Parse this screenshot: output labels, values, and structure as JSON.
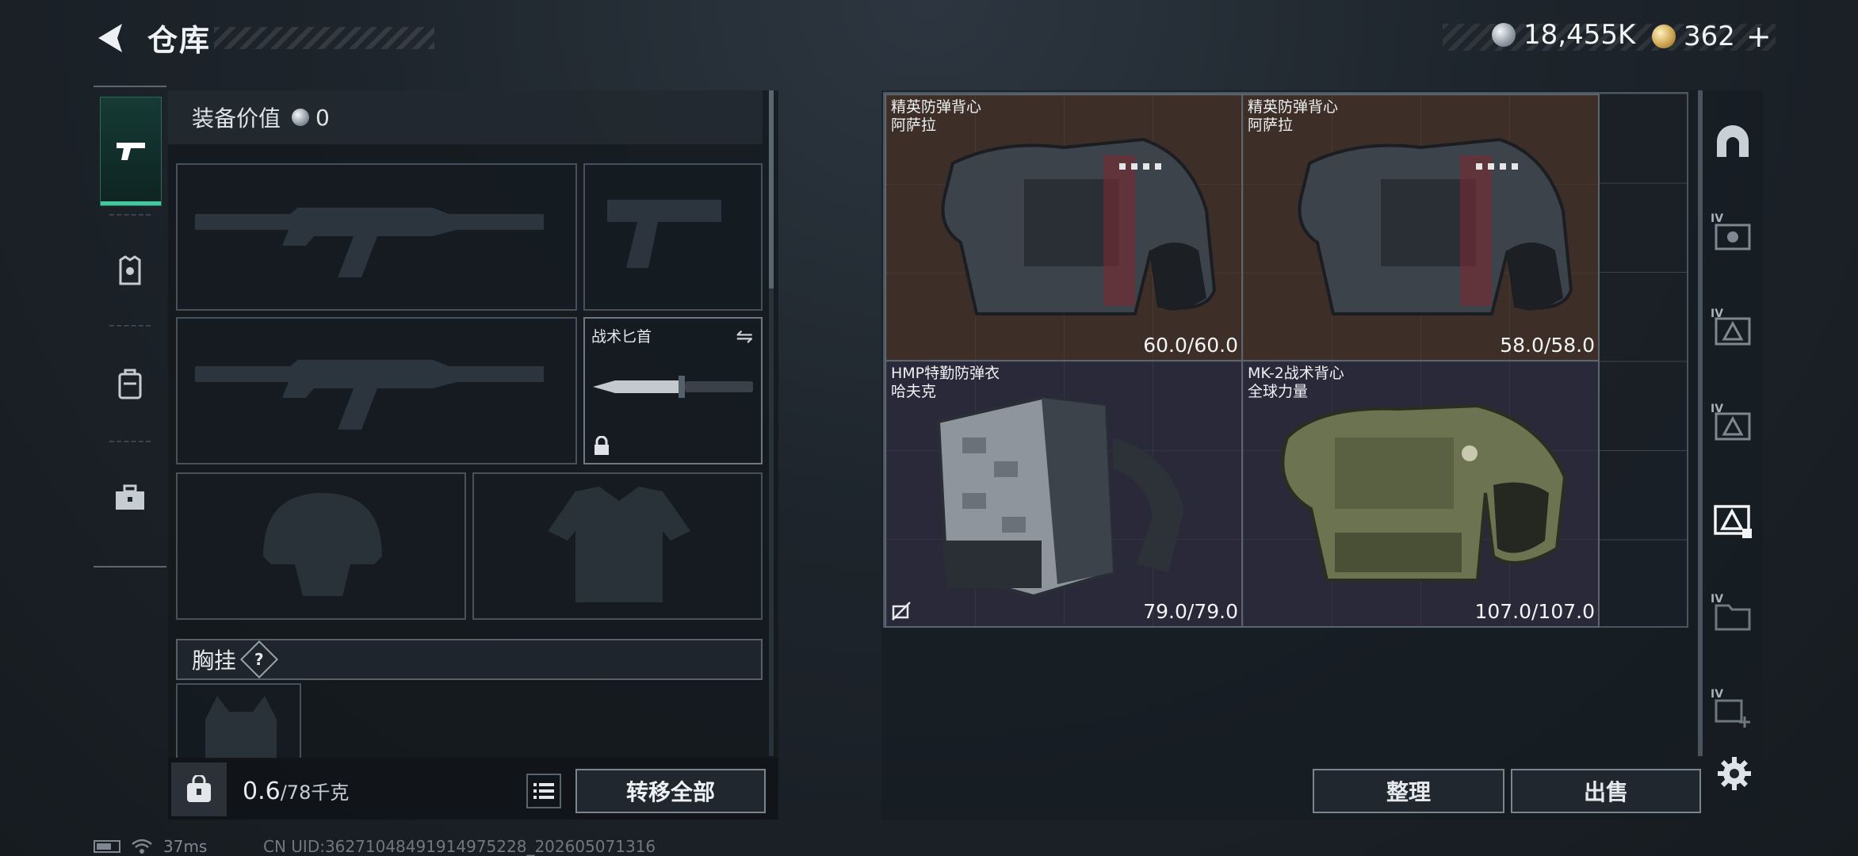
{
  "header": {
    "title": "仓库",
    "silver_amount": "18,455K",
    "gold_amount": "362",
    "gold_plus": "+"
  },
  "left_nav": {
    "items": [
      {
        "name": "weapons",
        "active": true
      },
      {
        "name": "armor",
        "active": false
      },
      {
        "name": "backpack",
        "active": false
      },
      {
        "name": "toolbox",
        "active": false
      }
    ]
  },
  "equipment": {
    "value_label": "装备价值",
    "value": "0",
    "knife_label": "战术匕首",
    "chest_label": "胸挂",
    "help_mark": "?"
  },
  "bottom_left": {
    "weight_current": "0.6",
    "weight_max": "/78千克",
    "transfer_all": "转移全部"
  },
  "warehouse": {
    "items": [
      {
        "line1": "精英防弹背心",
        "line2": "阿萨拉",
        "durability": "60.0/60.0",
        "bg": "brown"
      },
      {
        "line1": "精英防弹背心",
        "line2": "阿萨拉",
        "durability": "58.0/58.0",
        "bg": "brown"
      },
      {
        "line1": "HMP特勤防弹衣",
        "line2": "哈夫克",
        "durability": "79.0/79.0",
        "bg": "purple"
      },
      {
        "line1": "MK-2战术背心",
        "line2": "全球力量",
        "durability": "107.0/107.0",
        "bg": "purple"
      }
    ],
    "sort_label": "整理",
    "sell_label": "出售"
  },
  "right_nav": {
    "tags": [
      "IV",
      "IV",
      "IV",
      "IV",
      "IV"
    ]
  },
  "status_bar": {
    "ping": "37ms",
    "uid": "CN UID:36271048491914975228_202605071316"
  },
  "colors": {
    "accent": "#43c9a0",
    "brown_tile": "#3d2f27",
    "purple_tile": "#2a293a"
  }
}
